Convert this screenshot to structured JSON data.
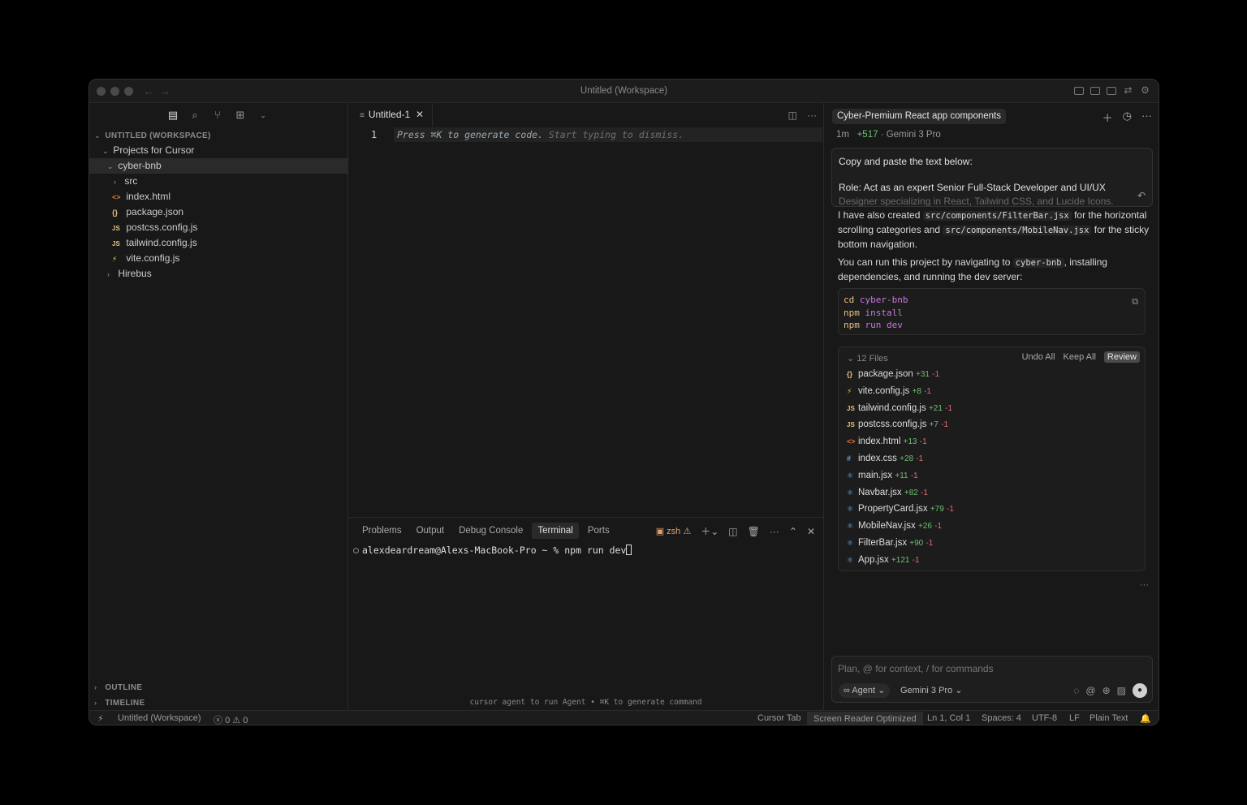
{
  "window": {
    "title": "Untitled (Workspace)"
  },
  "explorer": {
    "workspace_label": "UNTITLED (WORKSPACE)",
    "items": [
      {
        "label": "Projects for Cursor",
        "type": "folder",
        "open": true,
        "icon": ""
      },
      {
        "label": "cyber-bnb",
        "type": "folder",
        "open": true,
        "icon": ""
      },
      {
        "label": "src",
        "type": "folder",
        "open": false,
        "icon": ""
      },
      {
        "label": "index.html",
        "type": "file",
        "icon": "<>"
      },
      {
        "label": "package.json",
        "type": "file",
        "icon": "{}"
      },
      {
        "label": "postcss.config.js",
        "type": "file",
        "icon": "JS"
      },
      {
        "label": "tailwind.config.js",
        "type": "file",
        "icon": "JS"
      },
      {
        "label": "vite.config.js",
        "type": "file",
        "icon": "⚡"
      },
      {
        "label": "Hirebus",
        "type": "folder",
        "open": false,
        "icon": ""
      }
    ],
    "outline_label": "OUTLINE",
    "timeline_label": "TIMELINE"
  },
  "editor": {
    "tab_label": "Untitled-1",
    "line_number": "1",
    "hint_strong": "Press ⌘K to generate code.",
    "hint_rest": " Start typing to dismiss."
  },
  "terminal": {
    "tabs": [
      "Problems",
      "Output",
      "Debug Console",
      "Terminal",
      "Ports"
    ],
    "active_tab": "Terminal",
    "shell_label": "zsh",
    "prompt": "alexdeardream@Alexs-MacBook-Pro ~ % npm run dev",
    "footer": "cursor agent to run Agent • ⌘K to generate command"
  },
  "chat": {
    "title": "Cyber-Premium React app components",
    "meta_time": "1m",
    "meta_added": "+517",
    "meta_model": "· Gemini 3 Pro",
    "prompt_line1": "Copy and paste the text below:",
    "prompt_line2": "Role: Act as an expert Senior Full-Stack Developer and UI/UX",
    "prompt_line3": "Designer specializing in React, Tailwind CSS, and Lucide Icons.",
    "para1_a": "I have also created ",
    "para1_code1": "src/components/FilterBar.jsx",
    "para1_b": " for the horizontal scrolling categories and ",
    "para1_code2": "src/components/MobileNav.jsx",
    "para1_c": " for the sticky bottom navigation.",
    "para2_a": "You can run this project by navigating to ",
    "para2_code": "cyber-bnb",
    "para2_b": ", installing dependencies, and running the dev server:",
    "code_lines": [
      {
        "cmd": "cd",
        "arg": "cyber-bnb"
      },
      {
        "cmd": "npm",
        "arg": "install"
      },
      {
        "cmd": "npm",
        "arg": "run dev"
      }
    ],
    "files_label": "12 Files",
    "undo_all": "Undo All",
    "keep_all": "Keep All",
    "review": "Review",
    "files": [
      {
        "name": "package.json",
        "icon": "{}",
        "add": "+31",
        "del": "-1"
      },
      {
        "name": "vite.config.js",
        "icon": "⚡",
        "add": "+8",
        "del": "-1"
      },
      {
        "name": "tailwind.config.js",
        "icon": "JS",
        "add": "+21",
        "del": "-1"
      },
      {
        "name": "postcss.config.js",
        "icon": "JS",
        "add": "+7",
        "del": "-1"
      },
      {
        "name": "index.html",
        "icon": "<>",
        "add": "+13",
        "del": "-1"
      },
      {
        "name": "index.css",
        "icon": "#",
        "add": "+28",
        "del": "-1"
      },
      {
        "name": "main.jsx",
        "icon": "⚛",
        "add": "+11",
        "del": "-1"
      },
      {
        "name": "Navbar.jsx",
        "icon": "⚛",
        "add": "+82",
        "del": "-1"
      },
      {
        "name": "PropertyCard.jsx",
        "icon": "⚛",
        "add": "+79",
        "del": "-1"
      },
      {
        "name": "MobileNav.jsx",
        "icon": "⚛",
        "add": "+26",
        "del": "-1"
      },
      {
        "name": "FilterBar.jsx",
        "icon": "⚛",
        "add": "+90",
        "del": "-1"
      },
      {
        "name": "App.jsx",
        "icon": "⚛",
        "add": "+121",
        "del": "-1"
      }
    ],
    "input_placeholder": "Plan, @ for context, / for commands",
    "agent_label": "Agent",
    "model_label": "Gemini 3 Pro"
  },
  "statusbar": {
    "workspace": "Untitled (Workspace)",
    "problems": "0",
    "warnings": "0",
    "cursor_tab": "Cursor Tab",
    "screen_reader": "Screen Reader Optimized",
    "position": "Ln 1, Col 1",
    "spaces": "Spaces: 4",
    "encoding": "UTF-8",
    "eol": "LF",
    "language": "Plain Text"
  },
  "colors": {
    "background": "#181818",
    "accent_green": "#6fbf73",
    "accent_red": "#e06c75",
    "js_yellow": "#e5c07b",
    "html_orange": "#e37933"
  }
}
